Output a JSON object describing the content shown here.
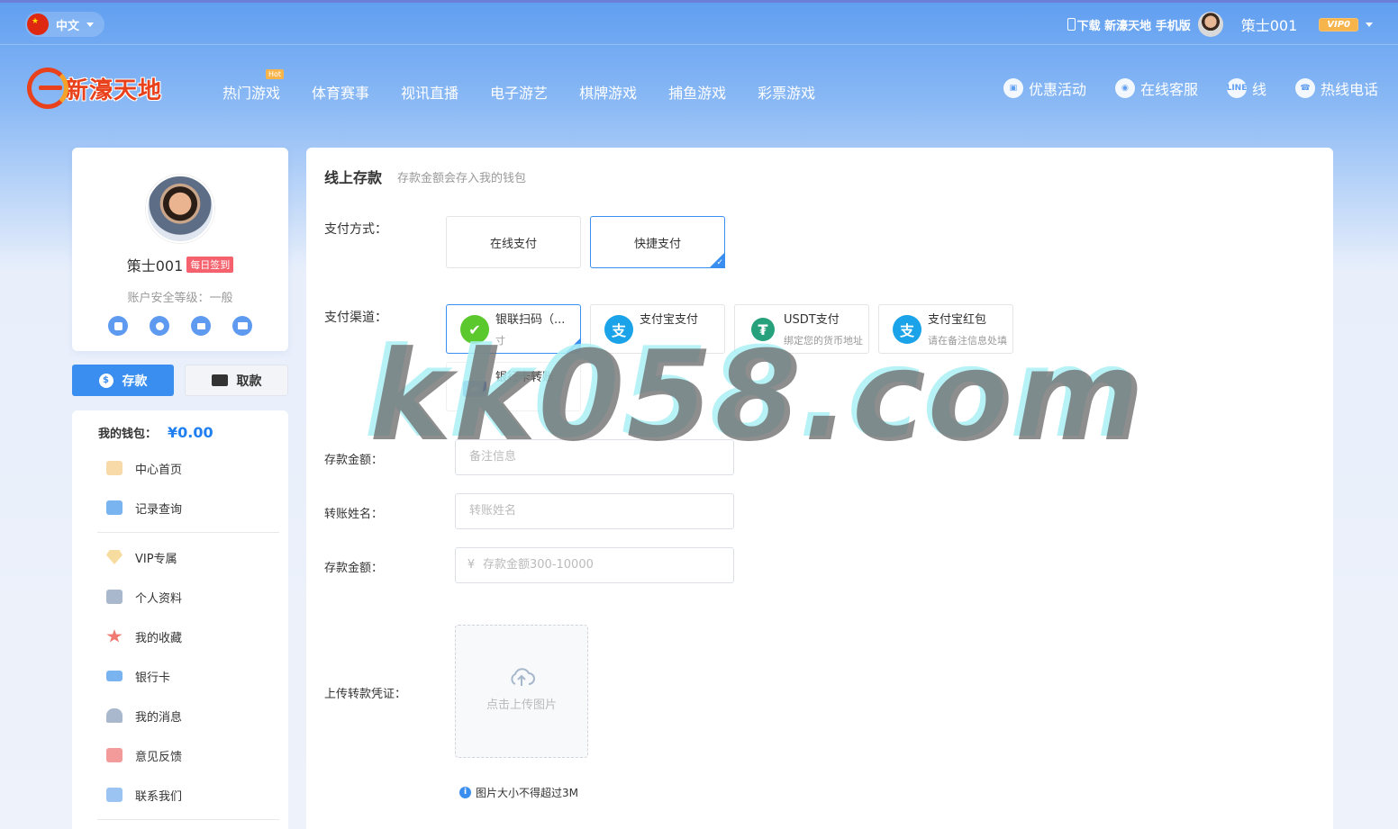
{
  "topbar": {
    "lang": "中文",
    "download": "下载 新濠天地 手机版",
    "username": "策士001",
    "vip": "VIP0"
  },
  "header": {
    "logo": "新濠天地",
    "nav": [
      "热门游戏",
      "体育赛事",
      "视讯直播",
      "电子游艺",
      "棋牌游戏",
      "捕鱼游戏",
      "彩票游戏"
    ],
    "hot_badge": "Hot",
    "right": [
      {
        "label": "优惠活动",
        "icon": "gift-icon"
      },
      {
        "label": "在线客服",
        "icon": "headset-icon"
      },
      {
        "label": "线",
        "icon": "line-icon",
        "icon_text": "LINE"
      },
      {
        "label": "热线电话",
        "icon": "phone-icon"
      }
    ]
  },
  "profile": {
    "username": "策士001",
    "checkin": "每日签到",
    "security": "账户安全等级：一般",
    "icons": [
      "mobile-icon",
      "user-icon",
      "mail-icon",
      "card-icon"
    ]
  },
  "actions": {
    "deposit": "存款",
    "withdraw": "取款"
  },
  "wallet": {
    "label": "我的钱包：",
    "amount": "¥0.00"
  },
  "menu": [
    "中心首页",
    "记录查询",
    "VIP专属",
    "个人资料",
    "我的收藏",
    "银行卡",
    "我的消息",
    "意见反馈",
    "联系我们"
  ],
  "deposit": {
    "title": "线上存款",
    "subtitle": "存款金额会存入我的钱包",
    "method_label": "支付方式：",
    "methods": [
      "在线支付",
      "快捷支付"
    ],
    "channel_label": "支付渠道：",
    "channels": [
      {
        "name": "银联扫码（...",
        "desc": "寸",
        "color": "#5bc82d",
        "glyph": "✔"
      },
      {
        "name": "支付宝支付",
        "desc": "",
        "color": "#1aa3e8",
        "glyph": "支"
      },
      {
        "name": "USDT支付",
        "desc": "绑定您的货币地址",
        "color": "#26a17b",
        "glyph": "₮"
      },
      {
        "name": "支付宝红包",
        "desc": "请在备注信息处填",
        "color": "#1aa3e8",
        "glyph": "支"
      },
      {
        "name": "银行卡转账",
        "desc": "",
        "color": "#4a7fd8",
        "glyph": "▬"
      }
    ],
    "amount_label": "存款金额：",
    "remark_placeholder": "备注信息",
    "name_label": "转账姓名：",
    "name_placeholder": "转账姓名",
    "amount2_label": "存款金额：",
    "currency": "¥",
    "amount_placeholder": "存款金额300-10000",
    "upload_label": "上传转款凭证：",
    "upload_text": "点击上传图片",
    "note": "图片大小不得超过3M"
  },
  "watermark": "kk058.com"
}
